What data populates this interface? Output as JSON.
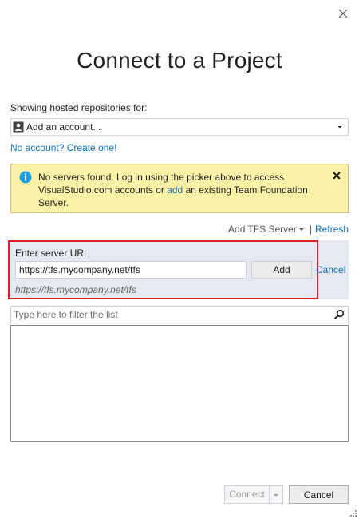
{
  "dialog": {
    "title": "Connect to a Project"
  },
  "accounts": {
    "label": "Showing hosted repositories for:",
    "selected": "Add an account...",
    "create_link": "No account? Create one!"
  },
  "info_bar": {
    "text_before": "No servers found. Log in using the picker above to access VisualStudio.com accounts or ",
    "link": "add",
    "text_after": " an existing Team Foundation Server."
  },
  "server_actions": {
    "add_tfs_label": "Add TFS Server",
    "separator": "|",
    "refresh_label": "Refresh"
  },
  "server_url": {
    "label": "Enter server URL",
    "value": "https://tfs.mycompany.net/tfs",
    "add_label": "Add",
    "cancel_label": "Cancel",
    "hint": "https://tfs.mycompany.net/tfs"
  },
  "filter": {
    "placeholder": "Type here to filter the list"
  },
  "footer": {
    "connect_label": "Connect",
    "cancel_label": "Cancel"
  },
  "icons": {
    "close": "close-icon",
    "account": "account-icon",
    "dropdown": "chevron-down-icon",
    "info": "info-icon",
    "dismiss": "dismiss-icon",
    "search": "search-icon"
  },
  "colors": {
    "link": "#0e70c0",
    "info_background": "#fcf2a7",
    "info_icon": "#1ba1e2",
    "highlight_border": "#e21d2a",
    "panel_background": "#e6e9f1"
  }
}
